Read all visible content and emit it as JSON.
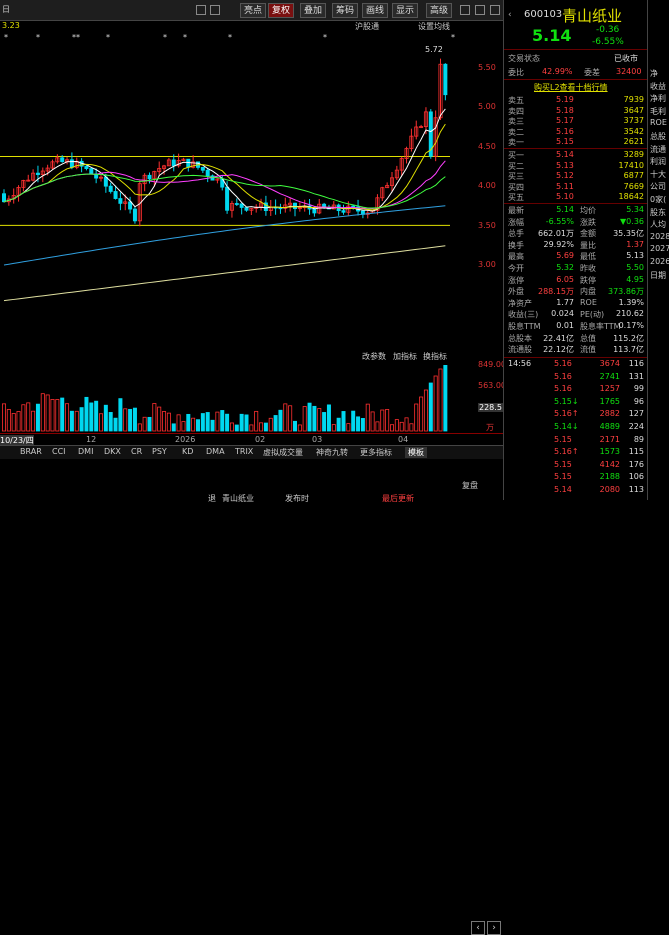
{
  "toolbar": {
    "date_prefix": "日",
    "items": [
      "亮点",
      "复权",
      "叠加",
      "筹码",
      "画线",
      "显示",
      "高级"
    ],
    "active": "复权"
  },
  "chart_sub": {
    "left": "3.23",
    "right1": "沪股通",
    "right2": "设置均线"
  },
  "y_axis": [
    "5.50",
    "5.00",
    "4.50",
    "4.00",
    "3.50",
    "3.00"
  ],
  "price_marker": "5.72",
  "volume_panel": {
    "labels": [
      "改参数",
      "加指标",
      "换指标"
    ],
    "y": [
      "849.00",
      "563.00",
      "228.5"
    ],
    "unit": "万"
  },
  "date_axis": [
    "10/23/四",
    "12",
    "2026",
    "02",
    "03",
    "04"
  ],
  "indicator_tabs": [
    "BRAR",
    "CCI",
    "DMI",
    "DKX",
    "CR",
    "PSY",
    "KD",
    "DMA",
    "TRIX",
    "虚拟成交量",
    "神奇九转",
    "更多指标",
    "模板"
  ],
  "bottom": {
    "a": "退",
    "b": "青山纸业",
    "c": "发布时",
    "d": "最后更新",
    "e": "复盘"
  },
  "quote": {
    "code": "600103",
    "name": "青山纸业",
    "price": "5.14",
    "change": "-0.36",
    "pct": "-6.55%",
    "status_label": "交易状态",
    "status": "已收市",
    "wb_label": "委比",
    "wb": "42.99%",
    "wc_label": "委差",
    "wc": "32400",
    "l2": "购买L2查看十档行情",
    "sells": [
      {
        "l": "卖五",
        "p": "5.19",
        "v": "7939"
      },
      {
        "l": "卖四",
        "p": "5.18",
        "v": "3647"
      },
      {
        "l": "卖三",
        "p": "5.17",
        "v": "3737"
      },
      {
        "l": "卖二",
        "p": "5.16",
        "v": "3542"
      },
      {
        "l": "卖一",
        "p": "5.15",
        "v": "2621"
      }
    ],
    "buys": [
      {
        "l": "买一",
        "p": "5.14",
        "v": "3289"
      },
      {
        "l": "买二",
        "p": "5.13",
        "v": "17410"
      },
      {
        "l": "买三",
        "p": "5.12",
        "v": "6877"
      },
      {
        "l": "买四",
        "p": "5.11",
        "v": "7669"
      },
      {
        "l": "买五",
        "p": "5.10",
        "v": "18642"
      }
    ],
    "stats": [
      {
        "a": "最新",
        "av": "5.14",
        "b": "均价",
        "bv": "5.34"
      },
      {
        "a": "涨幅",
        "av": "-6.55%",
        "b": "涨跌",
        "bv": "▼0.36"
      },
      {
        "a": "总手",
        "av": "662.01万",
        "b": "金额",
        "bv": "35.35亿"
      },
      {
        "a": "换手",
        "av": "29.92%",
        "b": "量比",
        "bv": "1.37"
      },
      {
        "a": "最高",
        "av": "5.69",
        "b": "最低",
        "bv": "5.13"
      },
      {
        "a": "今开",
        "av": "5.32",
        "b": "昨收",
        "bv": "5.50"
      },
      {
        "a": "涨停",
        "av": "6.05",
        "b": "跌停",
        "bv": "4.95"
      },
      {
        "a": "外盘",
        "av": "288.15万",
        "b": "内盘",
        "bv": "373.86万"
      },
      {
        "a": "净资产",
        "av": "1.77",
        "b": "ROE",
        "bv": "1.39%"
      },
      {
        "a": "收益(三)",
        "av": "0.024",
        "b": "PE(动)",
        "bv": "210.62"
      },
      {
        "a": "股息TTM",
        "av": "0.01",
        "b": "股息率TTM",
        "bv": "0.17%"
      },
      {
        "a": "总股本",
        "av": "22.41亿",
        "b": "总值",
        "bv": "115.2亿"
      },
      {
        "a": "流通股",
        "av": "22.12亿",
        "b": "流值",
        "bv": "113.7亿"
      }
    ],
    "ticks": [
      {
        "t": "14:56",
        "p": "5.16",
        "v": "3674",
        "n": "116"
      },
      {
        "t": "",
        "p": "5.16",
        "v": "2741",
        "n": "131"
      },
      {
        "t": "",
        "p": "5.16",
        "v": "1257",
        "n": "99"
      },
      {
        "t": "",
        "p": "5.15↓",
        "v": "1765",
        "n": "96"
      },
      {
        "t": "",
        "p": "5.16↑",
        "v": "2882",
        "n": "127"
      },
      {
        "t": "",
        "p": "5.14↓",
        "v": "4889",
        "n": "224"
      },
      {
        "t": "",
        "p": "5.15",
        "v": "2171",
        "n": "89"
      },
      {
        "t": "",
        "p": "5.16↑",
        "v": "1573",
        "n": "115"
      },
      {
        "t": "",
        "p": "5.15",
        "v": "4142",
        "n": "176"
      },
      {
        "t": "",
        "p": "5.15",
        "v": "2188",
        "n": "106"
      },
      {
        "t": "",
        "p": "5.14",
        "v": "2080",
        "n": "113"
      }
    ]
  },
  "far_right": [
    "净",
    "收益",
    "净利",
    "毛利",
    "ROE",
    "总股",
    "流通",
    "利润",
    "十大",
    "公司",
    "0家(",
    "股东",
    "人均",
    "2028",
    "2027",
    "2026",
    "日期"
  ]
}
